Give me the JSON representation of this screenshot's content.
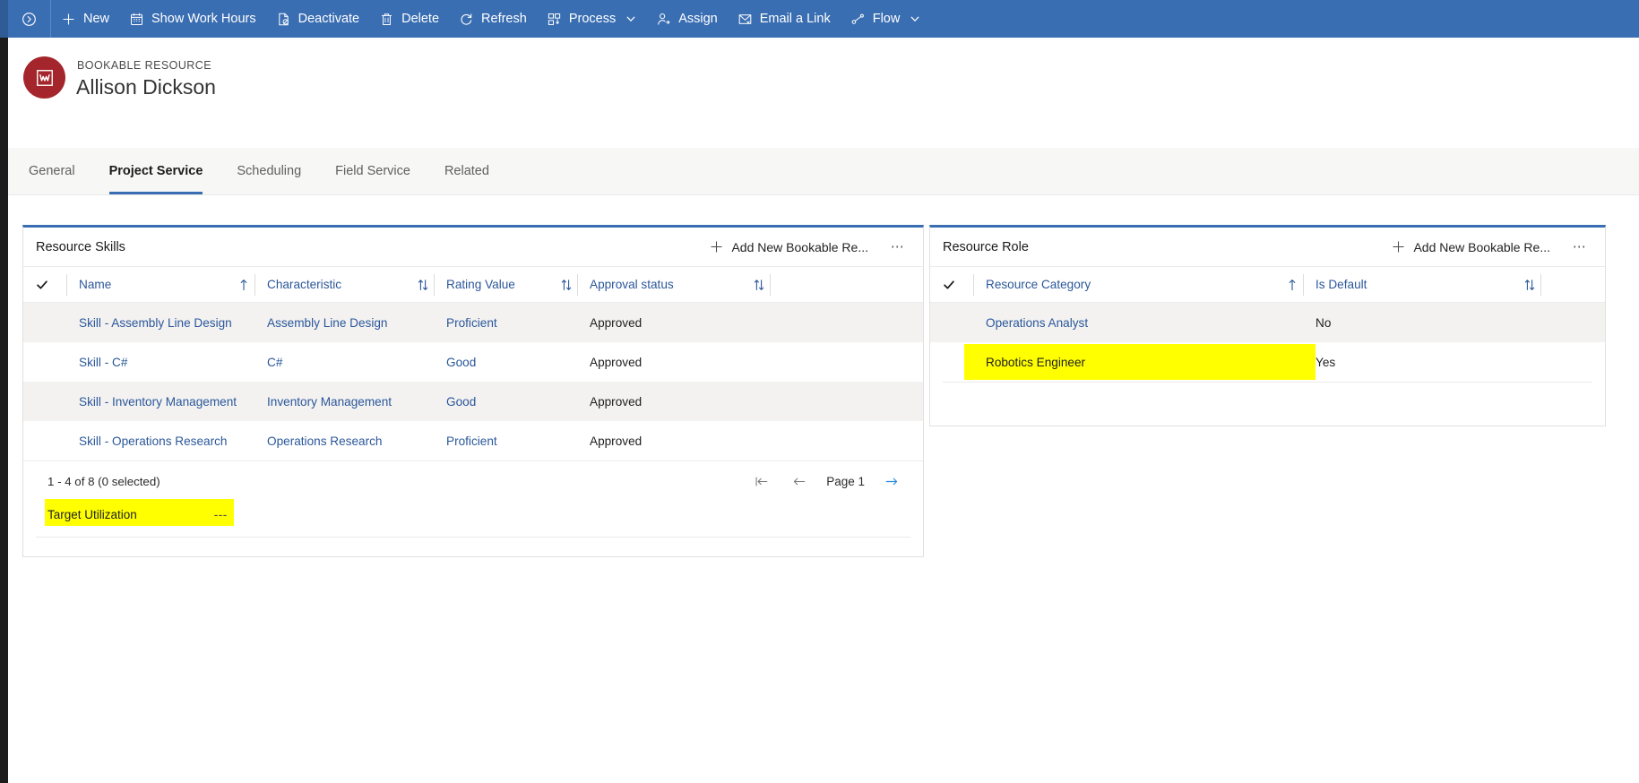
{
  "command_bar": {
    "expand_icon": "chevron-circle-right-icon",
    "items": [
      {
        "label": "New",
        "icon": "plus-icon",
        "caret": false
      },
      {
        "label": "Show Work Hours",
        "icon": "calendar-icon",
        "caret": false
      },
      {
        "label": "Deactivate",
        "icon": "deactivate-icon",
        "caret": false
      },
      {
        "label": "Delete",
        "icon": "trash-icon",
        "caret": false
      },
      {
        "label": "Refresh",
        "icon": "refresh-icon",
        "caret": false
      },
      {
        "label": "Process",
        "icon": "process-icon",
        "caret": true
      },
      {
        "label": "Assign",
        "icon": "person-icon",
        "caret": false
      },
      {
        "label": "Email a Link",
        "icon": "email-icon",
        "caret": false
      },
      {
        "label": "Flow",
        "icon": "flow-icon",
        "caret": true
      }
    ]
  },
  "record_header": {
    "entity_label": "BOOKABLE RESOURCE",
    "title": "Allison Dickson",
    "avatar_icon": "bookable-resource-icon"
  },
  "tabs": [
    {
      "label": "General",
      "active": false
    },
    {
      "label": "Project Service",
      "active": true
    },
    {
      "label": "Scheduling",
      "active": false
    },
    {
      "label": "Field Service",
      "active": false
    },
    {
      "label": "Related",
      "active": false
    }
  ],
  "resource_skills": {
    "title": "Resource Skills",
    "add_label": "Add New Bookable Re...",
    "more_label": "⋯",
    "columns": [
      {
        "label": "Name",
        "sort": "asc"
      },
      {
        "label": "Characteristic",
        "sort": "none"
      },
      {
        "label": "Rating Value",
        "sort": "none"
      },
      {
        "label": "Approval status",
        "sort": "none"
      }
    ],
    "rows": [
      {
        "name": "Skill - Assembly Line Design",
        "characteristic": "Assembly Line Design",
        "rating": "Proficient",
        "approval": "Approved"
      },
      {
        "name": "Skill - C#",
        "characteristic": "C#",
        "rating": "Good",
        "approval": "Approved"
      },
      {
        "name": "Skill - Inventory Management",
        "characteristic": "Inventory Management",
        "rating": "Good",
        "approval": "Approved"
      },
      {
        "name": "Skill - Operations Research",
        "characteristic": "Operations Research",
        "rating": "Proficient",
        "approval": "Approved"
      }
    ],
    "footer_count": "1 - 4 of 8 (0 selected)",
    "pager": {
      "first_label": "first-page",
      "prev_label": "previous-page",
      "page_label": "Page 1",
      "next_label": "next-page"
    }
  },
  "target_utilization": {
    "label": "Target Utilization",
    "value": "---"
  },
  "resource_role": {
    "title": "Resource Role",
    "add_label": "Add New Bookable Re...",
    "more_label": "⋯",
    "columns": [
      {
        "label": "Resource Category",
        "sort": "asc"
      },
      {
        "label": "Is Default",
        "sort": "none"
      }
    ],
    "rows": [
      {
        "category": "Operations Analyst",
        "is_default": "No",
        "highlighted": false
      },
      {
        "category": "Robotics Engineer",
        "is_default": "Yes",
        "highlighted": true
      }
    ]
  },
  "colors": {
    "command_bar": "#3a6eb2",
    "accent": "#3a6eb2",
    "link": "#2b579a",
    "avatar": "#a4262c",
    "highlight": "#ffff00",
    "row_alt": "#f3f2f1"
  }
}
